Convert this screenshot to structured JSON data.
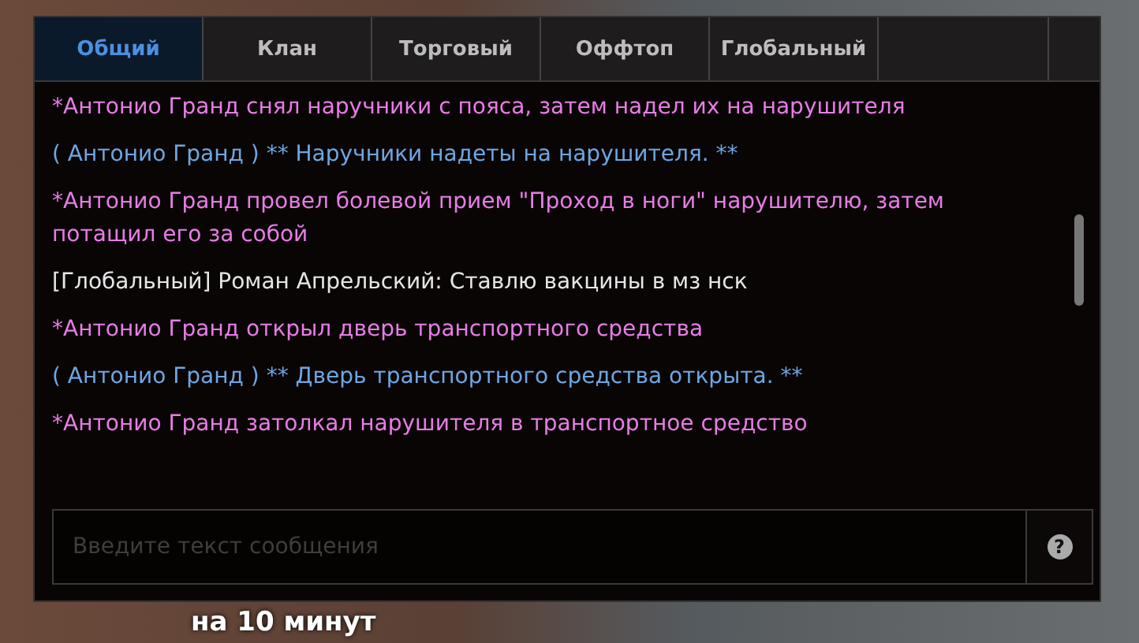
{
  "tabs": [
    {
      "label": "Общий",
      "selected": true
    },
    {
      "label": "Клан",
      "selected": false
    },
    {
      "label": "Торговый",
      "selected": false
    },
    {
      "label": "Оффтоп",
      "selected": false
    },
    {
      "label": "Глобальный",
      "selected": false
    }
  ],
  "messages": [
    {
      "kind": "action",
      "text": "*Антонио Гранд снял наручники с пояса, затем надел их на нарушителя"
    },
    {
      "kind": "do",
      "text": "( Антонио Гранд ) ** Наручники надеты на нарушителя. **"
    },
    {
      "kind": "action",
      "text": "*Антонио Гранд провел болевой прием \"Проход в ноги\" нарушителю, затем потащил его за собой"
    },
    {
      "kind": "global",
      "text": "[Глобальный] Роман Апрельский: Ставлю вакцины в мз нск"
    },
    {
      "kind": "action",
      "text": "*Антонио Гранд открыл дверь транспортного средства"
    },
    {
      "kind": "do",
      "text": "( Антонио Гранд ) ** Дверь транспортного средства открыта. **"
    },
    {
      "kind": "action",
      "text": "*Антонио Гранд затолкал нарушителя в транспортное средство"
    }
  ],
  "input": {
    "placeholder": "Введите текст сообщения",
    "help": "?"
  },
  "background_text": "на 10 минут"
}
